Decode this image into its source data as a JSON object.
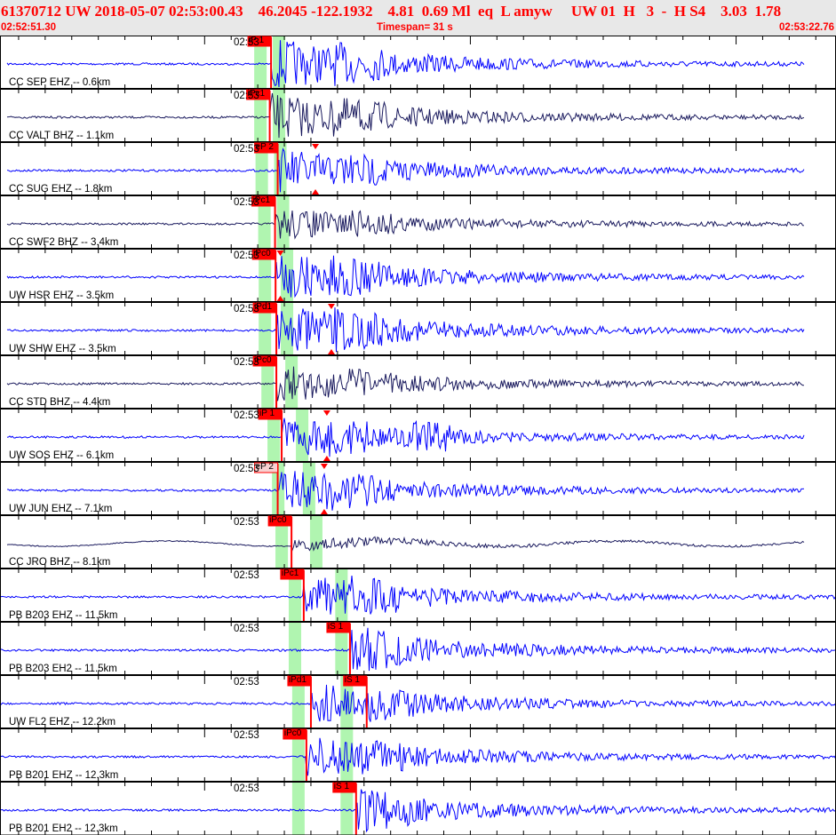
{
  "header": {
    "title": "61370712 UW 2018-05-07 02:53:00.43    46.2045 -122.1932    4.81  0.69 Ml  eq  L amyw     UW 01  H   3  -  H S4    3.03  1.78",
    "start_time": "02:52:51.30",
    "timespan": "Timespan=  31 s",
    "end_time": "02:53:22.76"
  },
  "colors": {
    "header_text": "#ff0000",
    "trace_blue": "#0000ff",
    "trace_navy": "#1a1a5e",
    "pick": "#ff0000",
    "window": "#b0f5b0"
  },
  "axis": {
    "span_seconds": 31.46,
    "minute_label": "02:53",
    "minute_offset_s": 8.7
  },
  "traces": [
    {
      "label": "CC SEP EHZ -- 0.6km",
      "color": "blue",
      "picks": [
        {
          "label": "iP 1",
          "t": 10.2
        }
      ],
      "windows": [
        9.8,
        10.5
      ],
      "s": 12.5,
      "amp": 28
    },
    {
      "label": "CC VALT BHZ -- 1.1km",
      "color": "navy",
      "picks": [
        {
          "label": "iPc1",
          "t": 10.15
        }
      ],
      "windows": [
        9.8,
        10.5
      ],
      "s": 12.5,
      "amp": 26
    },
    {
      "label": "CC SUG EHZ -- 1.8km",
      "color": "blue",
      "picks": [
        {
          "label": "eP 2",
          "t": 10.45
        }
      ],
      "windows": [
        9.85,
        10.55
      ],
      "s": 12.8,
      "amp": 24,
      "tri": 11.87
    },
    {
      "label": "CC SWF2 BHZ -- 3.4km",
      "color": "navy",
      "picks": [
        {
          "label": "iPc1",
          "t": 10.35
        }
      ],
      "windows": [
        9.95,
        10.65
      ],
      "s": 13.0,
      "amp": 18
    },
    {
      "label": "UW HSR EHZ -- 3.5km",
      "color": "blue",
      "picks": [
        {
          "label": "iPc0",
          "t": 10.37
        }
      ],
      "windows": [
        9.97,
        10.8
      ],
      "s": 12.3,
      "amp": 26,
      "tri": 10.55
    },
    {
      "label": "UW SHW EHZ -- 3.5km",
      "color": "blue",
      "picks": [
        {
          "label": "iPd1",
          "t": 10.4
        }
      ],
      "windows": [
        9.97,
        10.8
      ],
      "s": 12.5,
      "amp": 28,
      "tri": 12.47
    },
    {
      "label": "CC STD BHZ -- 4.4km",
      "color": "navy",
      "picks": [
        {
          "label": "iPc0",
          "t": 10.4
        }
      ],
      "windows": [
        10.07,
        10.97
      ],
      "s": 12.8,
      "amp": 20
    },
    {
      "label": "UW SOS EHZ -- 6.1km",
      "color": "blue",
      "picks": [
        {
          "label": "iP 1",
          "t": 10.6
        }
      ],
      "windows": [
        10.3,
        11.37
      ],
      "s": 12.3,
      "amp": 22,
      "tri": 12.3
    },
    {
      "label": "UW JUN EHZ -- 7.1km",
      "color": "blue",
      "picks": [
        {
          "label": "eP 2",
          "t": 10.45,
          "pale": true
        }
      ],
      "windows": [
        10.47,
        11.63
      ],
      "s": 12.2,
      "amp": 24,
      "tri": 12.2
    },
    {
      "label": "CC JRO BHZ -- 8.1km",
      "color": "navy",
      "picks": [
        {
          "label": "iPc0",
          "t": 10.97
        }
      ],
      "windows": [
        10.6,
        11.9
      ],
      "s": 12.5,
      "amp": 12
    },
    {
      "label": "PB B203 EHZ -- 11.5km",
      "color": "blue",
      "picks": [
        {
          "label": "iPc1",
          "t": 11.43
        }
      ],
      "windows": [
        11.1,
        12.85
      ],
      "s": 13.2,
      "amp": 24
    },
    {
      "label": "PB B203 EH2 -- 11.5km",
      "color": "blue",
      "picks": [
        {
          "label": "iS 1",
          "t": 13.17
        }
      ],
      "windows": [
        11.1,
        12.85
      ],
      "s": 13.17,
      "amp": 20
    },
    {
      "label": "UW FL2 EHZ -- 12.2km",
      "color": "blue",
      "picks": [
        {
          "label": "iPd1",
          "t": 11.7
        },
        {
          "label": "iS 1",
          "t": 13.8
        }
      ],
      "windows": [
        11.23,
        13.05
      ],
      "s": 13.8,
      "amp": 22
    },
    {
      "label": "PB B201 EHZ -- 12.3km",
      "color": "blue",
      "picks": [
        {
          "label": "iPc0",
          "t": 11.53
        }
      ],
      "windows": [
        11.23,
        13.05
      ],
      "s": 13.2,
      "amp": 22
    },
    {
      "label": "PB B201 EH2 -- 12.3km",
      "color": "blue",
      "picks": [
        {
          "label": "iS 1",
          "t": 13.4
        }
      ],
      "windows": [
        11.23,
        13.05
      ],
      "s": 13.4,
      "amp": 18
    }
  ]
}
